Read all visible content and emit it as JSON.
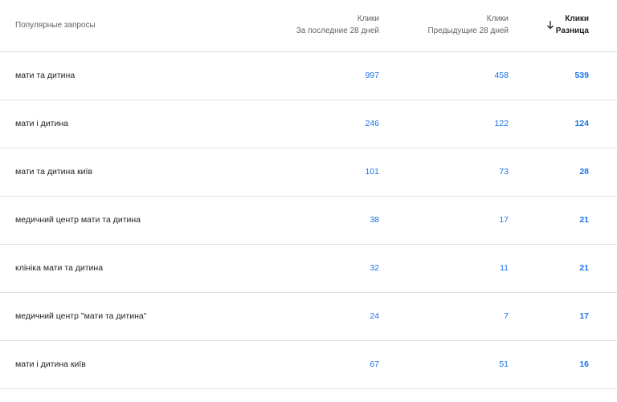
{
  "header": {
    "query_label": "Популярные запросы",
    "col1_line1": "Клики",
    "col1_line2": "За последние 28 дней",
    "col2_line1": "Клики",
    "col2_line2": "Предыдущие 28 дней",
    "col3_line1": "Клики",
    "col3_line2": "Разница",
    "sort_icon": "arrow-down-icon"
  },
  "rows": [
    {
      "query": "мати та дитина",
      "last28": "997",
      "prev28": "458",
      "diff": "539"
    },
    {
      "query": "мати і дитина",
      "last28": "246",
      "prev28": "122",
      "diff": "124"
    },
    {
      "query": "мати та дитина київ",
      "last28": "101",
      "prev28": "73",
      "diff": "28"
    },
    {
      "query": "медичний центр мати та дитина",
      "last28": "38",
      "prev28": "17",
      "diff": "21"
    },
    {
      "query": "клініка мати та дитина",
      "last28": "32",
      "prev28": "11",
      "diff": "21"
    },
    {
      "query": "медичний центр \"мати та дитина\"",
      "last28": "24",
      "prev28": "7",
      "diff": "17"
    },
    {
      "query": "мати і дитина київ",
      "last28": "67",
      "prev28": "51",
      "diff": "16"
    }
  ],
  "colors": {
    "link_blue": "#1a73e8",
    "divider": "#e0e0e0",
    "header_text": "#5f6368"
  }
}
